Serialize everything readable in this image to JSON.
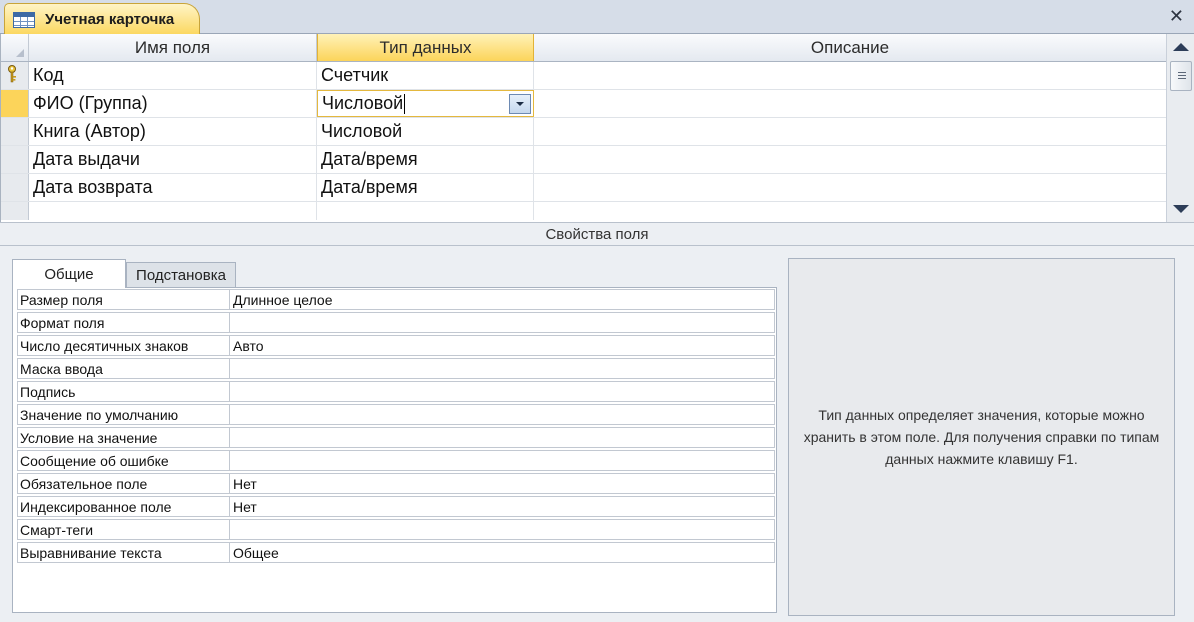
{
  "document_tab": {
    "title": "Учетная карточка",
    "icon": "table-icon"
  },
  "close_icon": "close-icon",
  "grid": {
    "columns": [
      "Имя поля",
      "Тип данных",
      "Описание"
    ],
    "rows": [
      {
        "name": "Код",
        "type": "Счетчик",
        "description": "",
        "primary_key": true
      },
      {
        "name": "ФИО (Группа)",
        "type": "Числовой",
        "description": "",
        "current": true
      },
      {
        "name": "Книга (Автор)",
        "type": "Числовой",
        "description": ""
      },
      {
        "name": "Дата выдачи",
        "type": "Дата/время",
        "description": ""
      },
      {
        "name": "Дата возврата",
        "type": "Дата/время",
        "description": ""
      },
      {
        "name": "",
        "type": "",
        "description": ""
      }
    ]
  },
  "field_properties_title": "Свойства поля",
  "property_tabs": [
    "Общие",
    "Подстановка"
  ],
  "properties": [
    {
      "label": "Размер поля",
      "value": "Длинное целое"
    },
    {
      "label": "Формат поля",
      "value": ""
    },
    {
      "label": "Число десятичных знаков",
      "value": "Авто"
    },
    {
      "label": "Маска ввода",
      "value": ""
    },
    {
      "label": "Подпись",
      "value": ""
    },
    {
      "label": "Значение по умолчанию",
      "value": ""
    },
    {
      "label": "Условие на значение",
      "value": ""
    },
    {
      "label": "Сообщение об ошибке",
      "value": ""
    },
    {
      "label": "Обязательное поле",
      "value": "Нет"
    },
    {
      "label": "Индексированное поле",
      "value": "Нет"
    },
    {
      "label": "Смарт-теги",
      "value": ""
    },
    {
      "label": "Выравнивание текста",
      "value": "Общее"
    }
  ],
  "help_text": "Тип данных определяет значения, которые можно хранить в этом поле. Для получения справки по типам данных нажмите клавишу F1.",
  "colors": {
    "accent": "#fcd45a",
    "chrome": "#d6dde8",
    "panel": "#eceff3"
  }
}
